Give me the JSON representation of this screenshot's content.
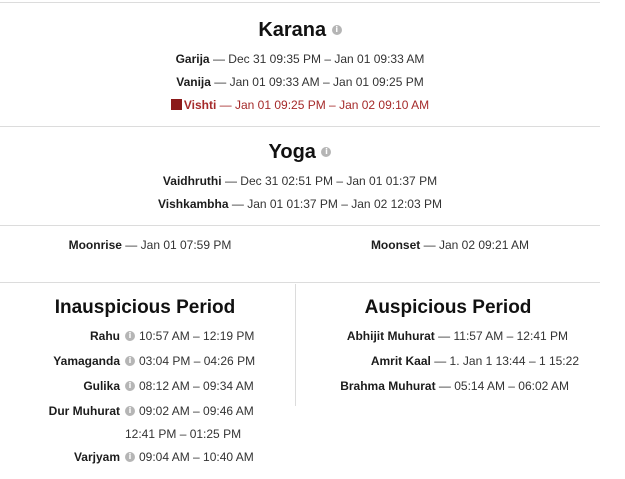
{
  "karana": {
    "title": "Karana",
    "items": [
      {
        "name": "Garija",
        "range": "Dec 31 09:35 PM – Jan 01 09:33 AM"
      },
      {
        "name": "Vanija",
        "range": "Jan 01 09:33 AM – Jan 01 09:25 PM"
      },
      {
        "name": "Vishti",
        "range": "Jan 01 09:25 PM – Jan 02 09:10 AM",
        "highlight": "#8b1a1a"
      }
    ]
  },
  "yoga": {
    "title": "Yoga",
    "items": [
      {
        "name": "Vaidhruthi",
        "range": "Dec 31 02:51 PM – Jan 01 01:37 PM"
      },
      {
        "name": "Vishkambha",
        "range": "Jan 01 01:37 PM – Jan 02 12:03 PM"
      }
    ]
  },
  "moon": {
    "moonrise_label": "Moonrise",
    "moonrise_value": "Jan 01 07:59 PM",
    "moonset_label": "Moonset",
    "moonset_value": "Jan 02 09:21 AM"
  },
  "inauspicious": {
    "title": "Inauspicious Period",
    "items": [
      {
        "label": "Rahu",
        "values": [
          "10:57 AM – 12:19 PM"
        ]
      },
      {
        "label": "Yamaganda",
        "values": [
          "03:04 PM – 04:26 PM"
        ]
      },
      {
        "label": "Gulika",
        "values": [
          "08:12 AM – 09:34 AM"
        ]
      },
      {
        "label": "Dur Muhurat",
        "values": [
          "09:02 AM – 09:46 AM",
          "12:41 PM – 01:25 PM"
        ]
      },
      {
        "label": "Varjyam",
        "values": [
          "09:04 AM – 10:40 AM"
        ]
      }
    ]
  },
  "auspicious": {
    "title": "Auspicious Period",
    "items": [
      {
        "label": "Abhijit Muhurat",
        "value": "11:57 AM – 12:41 PM"
      },
      {
        "label": "Amrit Kaal",
        "value": "1. Jan 1 13:44 – 1 15:22"
      },
      {
        "label": "Brahma Muhurat",
        "value": "05:14 AM – 06:02 AM"
      }
    ]
  },
  "colors": {
    "accent_red": "#a52a2a",
    "divider": "#dcdcdc",
    "info_icon": "#b5b5b5"
  },
  "icons": {
    "info": "info-icon"
  }
}
